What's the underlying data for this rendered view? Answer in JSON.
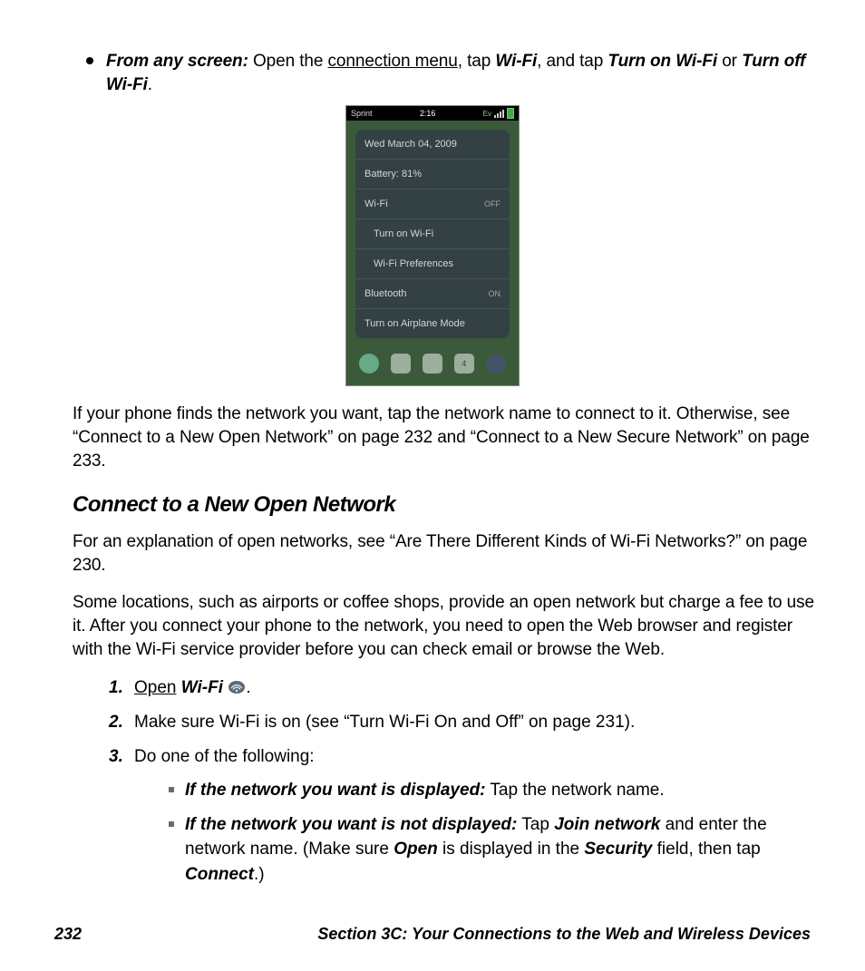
{
  "bullet1": {
    "lead": "From any screen:",
    "t1": " Open the ",
    "link1": "connection menu",
    "t2": ", tap ",
    "wifi": "Wi-Fi",
    "t3": ", and tap ",
    "turnon": "Turn on Wi-Fi",
    "t4": " or ",
    "turnoff": "Turn off Wi-Fi",
    "t5": "."
  },
  "phone": {
    "carrier": "Sprint",
    "time": "2:16",
    "date": "Wed March 04, 2009",
    "battery": "Battery: 81%",
    "wifi_label": "Wi-Fi",
    "wifi_state": "OFF",
    "turn_on_wifi": "Turn on Wi-Fi",
    "wifi_prefs": "Wi-Fi Preferences",
    "bt_label": "Bluetooth",
    "bt_state": "ON",
    "airplane": "Turn on Airplane Mode"
  },
  "para_after_image": "If your phone finds the network you want, tap the network name to connect to it. Otherwise, see “Connect to a New Open Network” on page 232 and “Connect to a New Secure Network” on page 233.",
  "heading": "Connect to a New Open Network",
  "para_explain": "For an explanation of open networks, see “Are There Different Kinds of Wi-Fi Networks?” on page 230.",
  "para_locations": "Some locations, such as airports or coffee shops, provide an open network but charge a fee to use it. After you connect your phone to the network, you need to open the Web browser and register with the Wi-Fi service provider before you can check email or browse the Web.",
  "steps": {
    "n1": "1.",
    "s1_open": "Open",
    "s1_wifi": "Wi-Fi",
    "s1_period": ".",
    "n2": "2.",
    "s2": "Make sure Wi-Fi is on (see “Turn Wi-Fi On and Off” on page 231).",
    "n3": "3.",
    "s3": "Do one of the following:",
    "sub1_lead": "If the network you want is displayed:",
    "sub1_rest": " Tap the network name.",
    "sub2_lead": "If the network you want is not displayed:",
    "sub2_t1": " Tap ",
    "sub2_join": "Join network",
    "sub2_t2": " and enter the network name. (Make sure ",
    "sub2_open": "Open",
    "sub2_t3": " is displayed in the ",
    "sub2_sec": "Security",
    "sub2_t4": " field, then tap ",
    "sub2_connect": "Connect",
    "sub2_t5": ".)"
  },
  "footer": {
    "page": "232",
    "section": "Section 3C: Your Connections to the Web and Wireless Devices"
  }
}
